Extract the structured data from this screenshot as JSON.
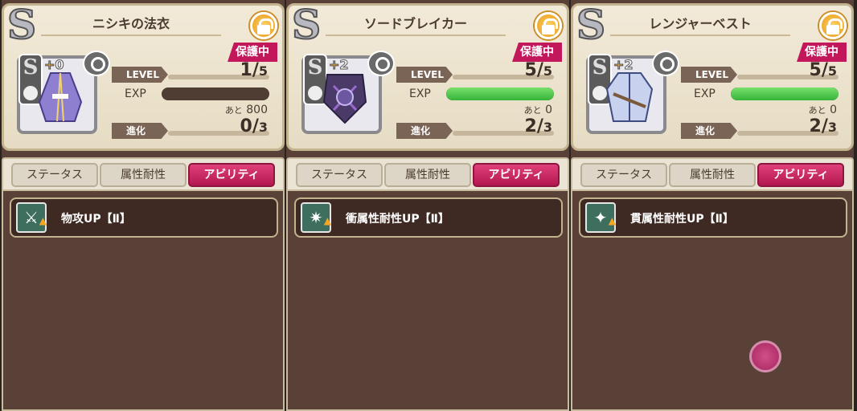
{
  "colors": {
    "protect": "#c2185b",
    "tab_active": "#d12e68",
    "exp_fill": "#4cc24a"
  },
  "panels": [
    {
      "rank": "S",
      "name": "ニシキの法衣",
      "protect": "保護中",
      "plus_count": "0",
      "item_icon": "robe-icon",
      "level_label": "LEVEL",
      "level": "1",
      "level_max": "5",
      "exp_label": "EXP",
      "exp_fraction": 0,
      "remain_prefix": "あと",
      "remain": "800",
      "evo_label": "進化",
      "evo": "0",
      "evo_max": "3",
      "tabs": [
        "ステータス",
        "属性耐性",
        "アビリティ"
      ],
      "ability": "物攻UP【Ⅱ】",
      "ability_icon": "sword-icon"
    },
    {
      "rank": "S",
      "name": "ソードブレイカー",
      "protect": "保護中",
      "plus_count": "2",
      "item_icon": "shield-icon",
      "level_label": "LEVEL",
      "level": "5",
      "level_max": "5",
      "exp_label": "EXP",
      "exp_fraction": 1,
      "remain_prefix": "あと",
      "remain": "0",
      "evo_label": "進化",
      "evo": "2",
      "evo_max": "3",
      "tabs": [
        "ステータス",
        "属性耐性",
        "アビリティ"
      ],
      "ability": "衝属性耐性UP【Ⅱ】",
      "ability_icon": "impact-icon"
    },
    {
      "rank": "S",
      "name": "レンジャーベスト",
      "protect": "保護中",
      "plus_count": "2",
      "item_icon": "vest-icon",
      "level_label": "LEVEL",
      "level": "5",
      "level_max": "5",
      "exp_label": "EXP",
      "exp_fraction": 1,
      "remain_prefix": "あと",
      "remain": "0",
      "evo_label": "進化",
      "evo": "2",
      "evo_max": "3",
      "tabs": [
        "ステータス",
        "属性耐性",
        "アビリティ"
      ],
      "ability": "貫属性耐性UP【Ⅱ】",
      "ability_icon": "pierce-icon"
    }
  ]
}
